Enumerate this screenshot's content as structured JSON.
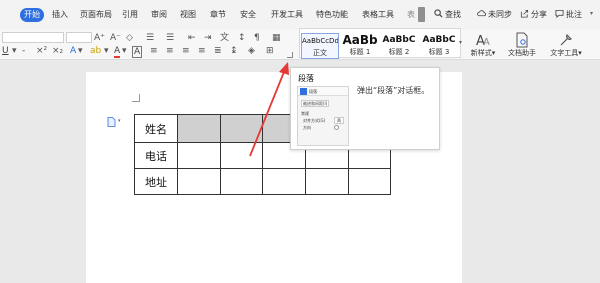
{
  "menu": {
    "tabs": [
      "开始",
      "插入",
      "页面布局",
      "引用",
      "审阅",
      "视图",
      "章节",
      "安全",
      "开发工具",
      "特色功能",
      "表格工具",
      "表"
    ],
    "search": "查找",
    "sync": "未同步",
    "share": "分享",
    "comment": "批注"
  },
  "ribbon": {
    "text_ops": [
      "U",
      "A",
      "A",
      "A"
    ],
    "styles": [
      {
        "sample": "AaBbCcDd",
        "name": "正文"
      },
      {
        "sample": "AaBb",
        "name": "标题 1"
      },
      {
        "sample": "AaBbC",
        "name": "标题 2"
      },
      {
        "sample": "AaBbC",
        "name": "标题 3"
      }
    ],
    "new_style": "新样式",
    "doc_assistant": "文档助手",
    "text_tools": "文字工具"
  },
  "tooltip": {
    "title": "段落",
    "description": "弹出“段落”对话框。",
    "preview": {
      "title": "段落",
      "indent_label": "缩进和间距(I)",
      "section_label": "常规",
      "align_label": "对齐方式(G)",
      "align_value": "两",
      "direction_label": "方向"
    }
  },
  "table": {
    "rows": [
      [
        "姓名",
        "",
        "",
        "",
        "",
        ""
      ],
      [
        "电话",
        "",
        "",
        "",
        "",
        ""
      ],
      [
        "地址",
        "",
        "",
        "",
        "",
        ""
      ]
    ]
  },
  "colors": {
    "accent": "#2f6fe0",
    "arrow": "#e53935",
    "header_fill": "#d0d0d0"
  }
}
